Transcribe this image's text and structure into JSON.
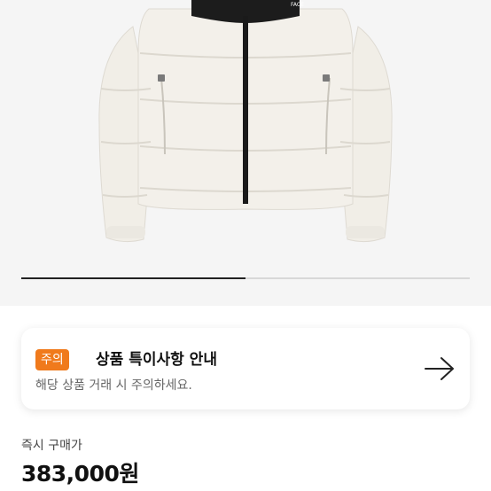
{
  "product": {
    "image_alt": "white puffer down jacket",
    "brand_text": "FACE"
  },
  "carousel": {
    "progress": 0.5
  },
  "notice": {
    "badge": "주의",
    "title": "상품 특이사항 안내",
    "description": "해당 상품 거래 시 주의하세요.",
    "arrow_icon": "arrow-right-icon",
    "badge_color": "#f07a1c"
  },
  "price": {
    "label": "즉시 구매가",
    "value": "383,000원"
  }
}
